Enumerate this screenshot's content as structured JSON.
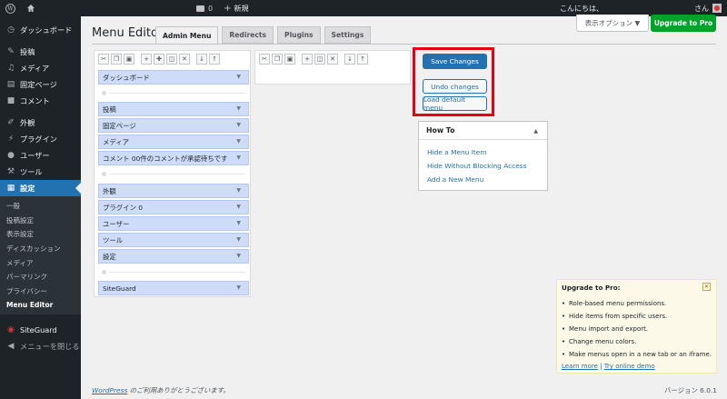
{
  "adminbar": {
    "comment_count": "0",
    "new_label": "新規",
    "greeting": "こんにちは、",
    "user_suffix": "さん"
  },
  "sidebar": {
    "items": [
      {
        "label": "ダッシュボード",
        "icon": "dashboard-icon"
      },
      {
        "label": "投稿",
        "icon": "pin-icon"
      },
      {
        "label": "メディア",
        "icon": "media-icon"
      },
      {
        "label": "固定ページ",
        "icon": "page-icon"
      },
      {
        "label": "コメント",
        "icon": "comment-icon"
      },
      {
        "label": "外観",
        "icon": "brush-icon"
      },
      {
        "label": "プラグイン",
        "icon": "plugin-icon"
      },
      {
        "label": "ユーザー",
        "icon": "user-icon"
      },
      {
        "label": "ツール",
        "icon": "wrench-icon"
      },
      {
        "label": "設定",
        "icon": "settings-icon"
      }
    ],
    "submenu": [
      "一般",
      "投稿設定",
      "表示設定",
      "ディスカッション",
      "メディア",
      "パーマリンク",
      "プライバシー",
      "Menu Editor"
    ],
    "siteguard": "SiteGuard",
    "collapse": "メニューを閉じる"
  },
  "header": {
    "screen_options": "表示オプション ▼",
    "upgrade_button": "Upgrade to Pro",
    "title": "Menu Editor"
  },
  "tabs": [
    "Admin Menu",
    "Redirects",
    "Plugins",
    "Settings"
  ],
  "menu_rows": {
    "r1": "ダッシュボード",
    "r2": "投稿",
    "r3": "固定ページ",
    "r4": "メディア",
    "r5": "コメント 00件のコメントが承認待ちです",
    "r6": "外観",
    "r7": "プラグイン 0",
    "r8": "ユーザー",
    "r9": "ツール",
    "r10": "設定",
    "r11": "SiteGuard"
  },
  "actions": {
    "save": "Save Changes",
    "undo": "Undo changes",
    "load_default": "Load default menu"
  },
  "howto": {
    "title": "How To",
    "links": [
      "Hide a Menu Item",
      "Hide Without Blocking Access",
      "Add a New Menu"
    ]
  },
  "pro_box": {
    "title": "Upgrade to Pro:",
    "features": [
      "Role-based menu permissions.",
      "Hide items from specific users.",
      "Menu import and export.",
      "Change menu colors.",
      "Make menus open in a new tab or an iframe."
    ],
    "learn_more": "Learn more",
    "separator": "|",
    "try_demo": "Try online demo"
  },
  "footer": {
    "wp_link": "WordPress",
    "thanks": "のご利用ありがとうございます。",
    "version": "バージョン 6.0.1"
  },
  "colors": {
    "highlight": "#e60012",
    "primary": "#2271b1",
    "upgrade": "#00a32a",
    "row": "#cfdcf8"
  }
}
